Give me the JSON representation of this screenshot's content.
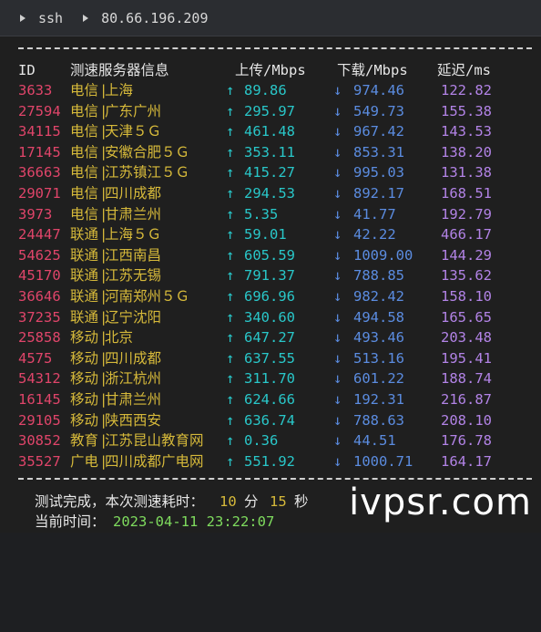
{
  "titlebar": {
    "tab1_label": "ssh",
    "host": "80.66.196.209"
  },
  "table": {
    "headers": [
      "ID",
      "测速服务器信息",
      "上传/Mbps",
      "下载/Mbps",
      "延迟/ms"
    ],
    "rows": [
      {
        "id": "3633",
        "isp": "电信",
        "loc": "上海",
        "up": "89.86",
        "down": "974.46",
        "lat": "122.82"
      },
      {
        "id": "27594",
        "isp": "电信",
        "loc": "广东广州",
        "up": "295.97",
        "down": "549.73",
        "lat": "155.38"
      },
      {
        "id": "34115",
        "isp": "电信",
        "loc": "天津５Ｇ",
        "up": "461.48",
        "down": "967.42",
        "lat": "143.53"
      },
      {
        "id": "17145",
        "isp": "电信",
        "loc": "安徽合肥５Ｇ",
        "up": "353.11",
        "down": "853.31",
        "lat": "138.20"
      },
      {
        "id": "36663",
        "isp": "电信",
        "loc": "江苏镇江５Ｇ",
        "up": "415.27",
        "down": "995.03",
        "lat": "131.38"
      },
      {
        "id": "29071",
        "isp": "电信",
        "loc": "四川成都",
        "up": "294.53",
        "down": "892.17",
        "lat": "168.51"
      },
      {
        "id": "3973",
        "isp": "电信",
        "loc": "甘肃兰州",
        "up": "5.35",
        "down": "41.77",
        "lat": "192.79"
      },
      {
        "id": "24447",
        "isp": "联通",
        "loc": "上海５Ｇ",
        "up": "59.01",
        "down": "42.22",
        "lat": "466.17"
      },
      {
        "id": "54625",
        "isp": "联通",
        "loc": "江西南昌",
        "up": "605.59",
        "down": "1009.00",
        "lat": "144.29"
      },
      {
        "id": "45170",
        "isp": "联通",
        "loc": "江苏无锡",
        "up": "791.37",
        "down": "788.85",
        "lat": "135.62"
      },
      {
        "id": "36646",
        "isp": "联通",
        "loc": "河南郑州５Ｇ",
        "up": "696.96",
        "down": "982.42",
        "lat": "158.10"
      },
      {
        "id": "37235",
        "isp": "联通",
        "loc": "辽宁沈阳",
        "up": "340.60",
        "down": "494.58",
        "lat": "165.65"
      },
      {
        "id": "25858",
        "isp": "移动",
        "loc": "北京",
        "up": "647.27",
        "down": "493.46",
        "lat": "203.48"
      },
      {
        "id": "4575",
        "isp": "移动",
        "loc": "四川成都",
        "up": "637.55",
        "down": "513.16",
        "lat": "195.41"
      },
      {
        "id": "54312",
        "isp": "移动",
        "loc": "浙江杭州",
        "up": "311.70",
        "down": "601.22",
        "lat": "188.74"
      },
      {
        "id": "16145",
        "isp": "移动",
        "loc": "甘肃兰州",
        "up": "624.66",
        "down": "192.31",
        "lat": "216.87"
      },
      {
        "id": "29105",
        "isp": "移动",
        "loc": "陕西西安",
        "up": "636.74",
        "down": "788.63",
        "lat": "208.10"
      },
      {
        "id": "30852",
        "isp": "教育",
        "loc": "江苏昆山教育网",
        "up": "0.36",
        "down": "44.51",
        "lat": "176.78"
      },
      {
        "id": "35527",
        "isp": "广电",
        "loc": "四川成都广电网",
        "up": "551.92",
        "down": "1000.71",
        "lat": "164.17"
      }
    ]
  },
  "summary": {
    "done_prefix": "测试完成，本次测速耗时：",
    "minutes": "10",
    "min_unit": "分",
    "seconds": "15",
    "sec_unit": "秒",
    "time_label": "当前时间：",
    "time_value": "2023-04-11 23:22:07"
  },
  "watermark": "ivpsr.com",
  "symbols": {
    "sep": "|",
    "up_arrow": "↑",
    "down_arrow": "↓"
  },
  "colors": {
    "id": "#e0456a",
    "isp": "#d6b93a",
    "up": "#29c7c9",
    "down": "#5b8ce0",
    "latency": "#b283e6",
    "time": "#7fdc5e"
  }
}
